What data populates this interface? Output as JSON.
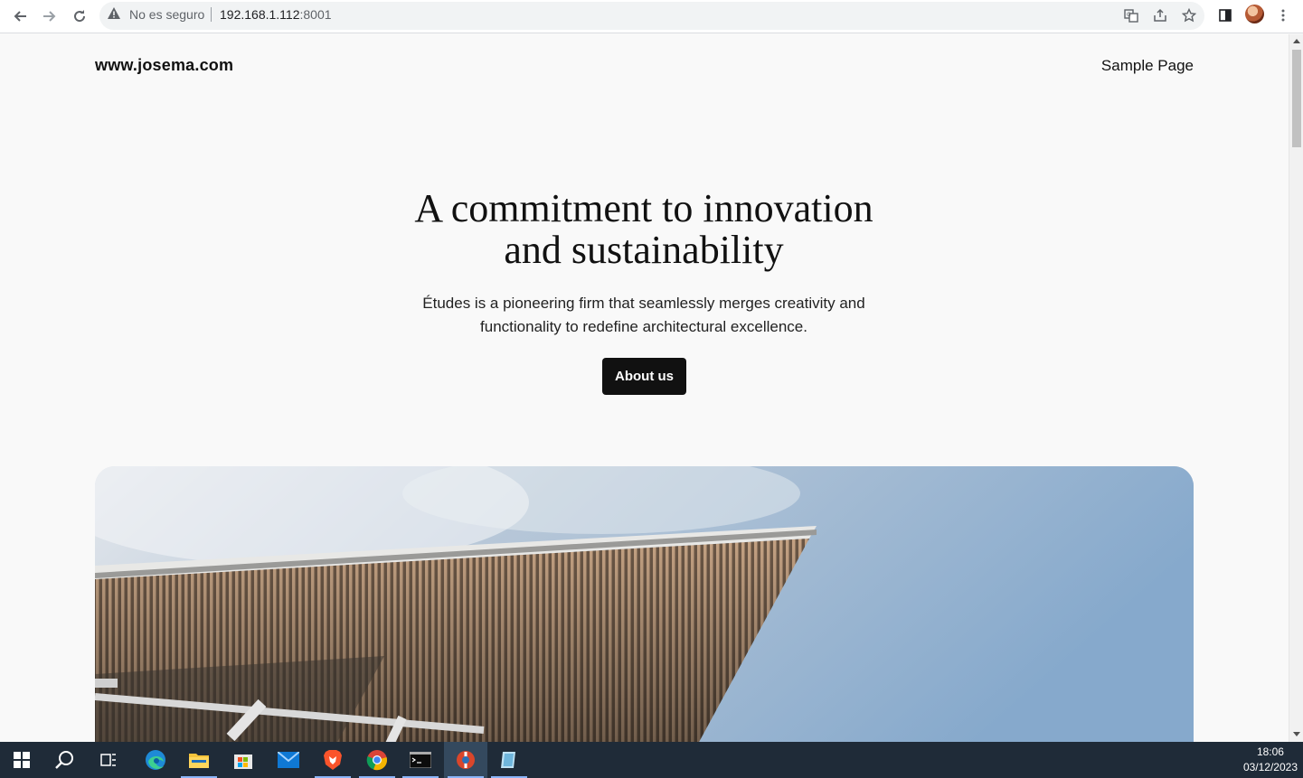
{
  "browser": {
    "security_label": "No es seguro",
    "url_host": "192.168.1.112",
    "url_port": ":8001",
    "icons": [
      "back-icon",
      "forward-icon",
      "reload-icon",
      "warning-icon",
      "translate-icon",
      "share-icon",
      "bookmark-star-icon",
      "side-panel-icon",
      "profile-avatar",
      "menu-icon"
    ]
  },
  "site": {
    "title": "www.josema.com",
    "nav": [
      "Sample Page"
    ]
  },
  "hero": {
    "title_line1": "A commitment to innovation",
    "title_line2": "and sustainability",
    "subtitle_line1": "Études is a pioneering firm that seamlessly merges creativity and",
    "subtitle_line2": "functionality to redefine architectural excellence.",
    "cta_label": "About us"
  },
  "taskbar": {
    "apps": [
      "windows-start-icon",
      "search-icon",
      "task-view-icon",
      "edge-icon",
      "file-explorer-icon",
      "store-icon",
      "mail-icon",
      "brave-icon",
      "chrome-icon",
      "terminal-icon",
      "app-icon",
      "app-icon-2"
    ],
    "time": "18:06",
    "date": "03/12/2023"
  },
  "colors": {
    "button_bg": "#111111",
    "page_bg": "#f9f9f9",
    "taskbar_bg": "#1f2b38"
  }
}
